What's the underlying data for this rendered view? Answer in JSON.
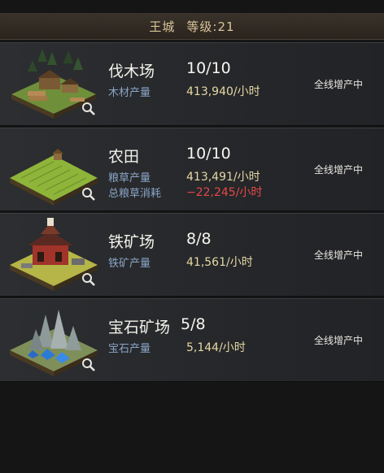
{
  "header": {
    "city": "王城",
    "level": "等级:21"
  },
  "buildings": [
    {
      "name": "伐木场",
      "level": "10/10",
      "stats": [
        {
          "label": "木材产量",
          "value": "413,940/小时"
        }
      ],
      "status": "全线增产中",
      "icon": "lumber-mill-icon"
    },
    {
      "name": "农田",
      "level": "10/10",
      "stats": [
        {
          "label": "粮草产量",
          "value": "413,491/小时"
        },
        {
          "label": "总粮草消耗",
          "value": "−22,245/小时"
        }
      ],
      "status": "全线增产中",
      "icon": "farm-icon"
    },
    {
      "name": "铁矿场",
      "level": "8/8",
      "stats": [
        {
          "label": "铁矿产量",
          "value": "41,561/小时"
        }
      ],
      "status": "全线增产中",
      "icon": "iron-mine-icon"
    },
    {
      "name": "宝石矿场",
      "level": "5/8",
      "stats": [
        {
          "label": "宝石产量",
          "value": "5,144/小时"
        }
      ],
      "status": "全线增产中",
      "icon": "gem-mine-icon"
    }
  ],
  "colors": {
    "accent": "#e6d8a4",
    "label": "#8aa4c6",
    "negative": "#e44848"
  }
}
